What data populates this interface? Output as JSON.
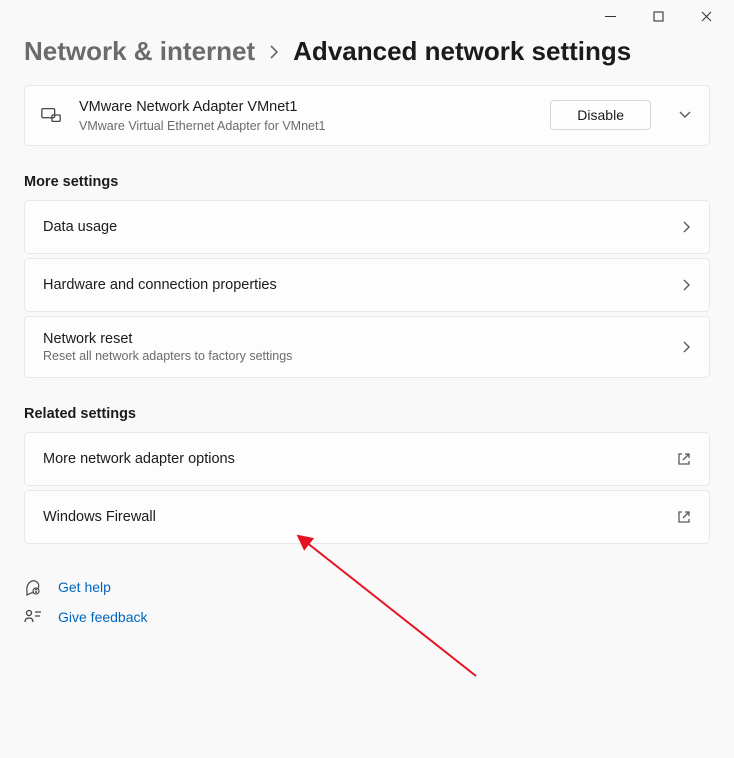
{
  "breadcrumb": {
    "parent": "Network & internet",
    "current": "Advanced network settings"
  },
  "adapter": {
    "title": "VMware Network Adapter VMnet1",
    "subtitle": "VMware Virtual Ethernet Adapter for VMnet1",
    "button_label": "Disable"
  },
  "sections": {
    "more_settings_header": "More settings",
    "related_settings_header": "Related settings",
    "data_usage": "Data usage",
    "hardware_props": "Hardware and connection properties",
    "network_reset_title": "Network reset",
    "network_reset_sub": "Reset all network adapters to factory settings",
    "more_adapter_options": "More network adapter options",
    "windows_firewall": "Windows Firewall"
  },
  "help": {
    "get_help": "Get help",
    "give_feedback": "Give feedback"
  }
}
